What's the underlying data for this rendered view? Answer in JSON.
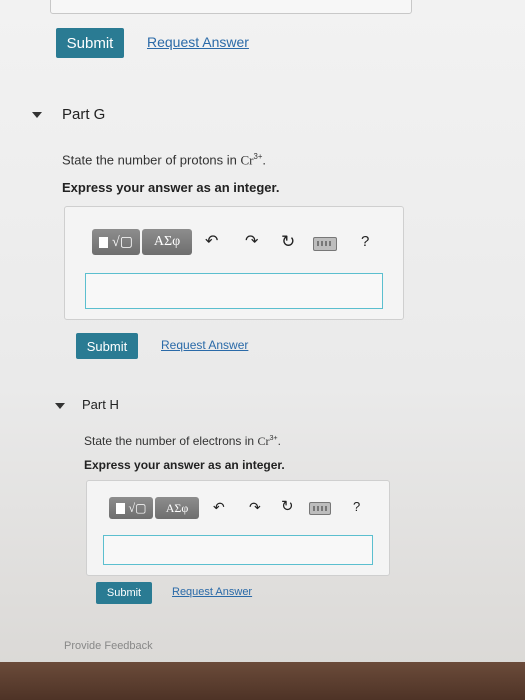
{
  "part_f": {
    "submit_label": "Submit",
    "request_label": "Request Answer"
  },
  "part_g": {
    "title": "Part G",
    "question_prefix": "State the number of protons in ",
    "ion_symbol": "Cr",
    "ion_charge": "3+",
    "question_suffix": ".",
    "instruction": "Express your answer as an integer.",
    "toolbar_symbols": "ΑΣφ",
    "help_label": "?",
    "answer_value": "",
    "submit_label": "Submit",
    "request_label": "Request Answer"
  },
  "part_h": {
    "title": "Part H",
    "question_prefix": "State the number of electrons in ",
    "ion_symbol": "Cr",
    "ion_charge": "3+",
    "question_suffix": ".",
    "instruction": "Express your answer as an integer.",
    "toolbar_symbols": "ΑΣφ",
    "help_label": "?",
    "answer_value": "",
    "submit_label": "Submit",
    "request_label": "Request Answer"
  },
  "footer": {
    "feedback_label": "Provide Feedback"
  },
  "colors": {
    "button": "#2a7b93",
    "link": "#2a6aa8",
    "input_border": "#5bbfcf"
  }
}
